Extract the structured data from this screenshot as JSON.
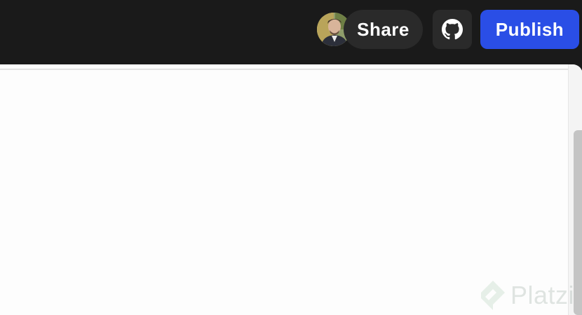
{
  "header": {
    "share_label": "Share",
    "publish_label": "Publish",
    "github_icon": "github-icon",
    "avatar_icon": "user-avatar"
  },
  "watermark": {
    "text": "Platzi",
    "icon": "platzi-logo-icon"
  },
  "colors": {
    "topbar_bg": "#1a1a1a",
    "share_bg": "#2a2a2a",
    "publish_bg": "#2a4ee6",
    "content_bg": "#fdfdfd"
  }
}
